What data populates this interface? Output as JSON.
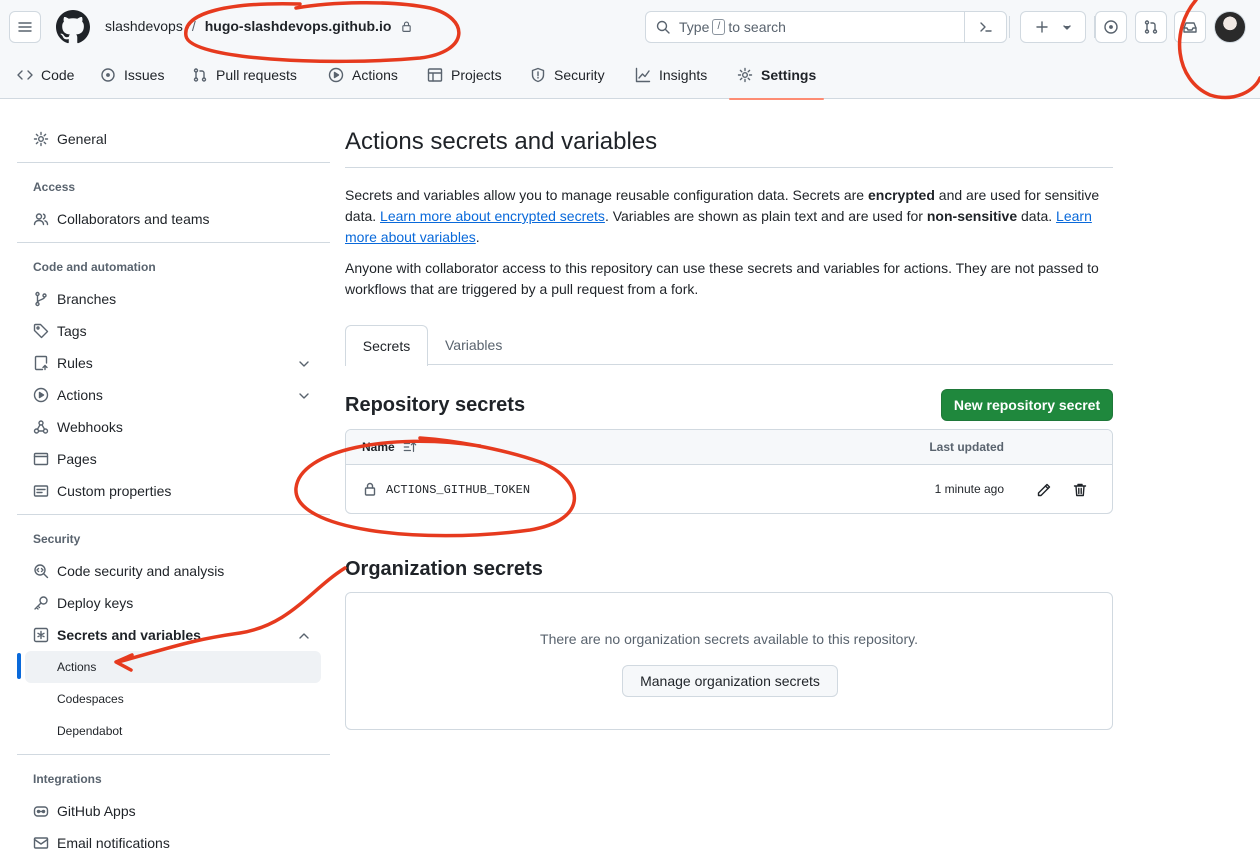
{
  "header": {
    "owner": "slashdevops",
    "separator": "/",
    "repo": "hugo-slashdevops.github.io",
    "search_type": "Type",
    "search_key": "/",
    "search_suffix": "to search"
  },
  "repo_nav": [
    {
      "label": "Code",
      "icon": "code-icon"
    },
    {
      "label": "Issues",
      "icon": "issue-opened-icon"
    },
    {
      "label": "Pull requests",
      "icon": "git-pull-request-icon"
    },
    {
      "label": "Actions",
      "icon": "play-icon"
    },
    {
      "label": "Projects",
      "icon": "table-icon"
    },
    {
      "label": "Security",
      "icon": "shield-icon"
    },
    {
      "label": "Insights",
      "icon": "graph-icon"
    },
    {
      "label": "Settings",
      "icon": "gear-icon",
      "active": true
    }
  ],
  "sidebar": {
    "general": "General",
    "access_heading": "Access",
    "collaborators": "Collaborators and teams",
    "code_heading": "Code and automation",
    "branches": "Branches",
    "tags": "Tags",
    "rules": "Rules",
    "actions": "Actions",
    "webhooks": "Webhooks",
    "pages": "Pages",
    "custom_properties": "Custom properties",
    "security_heading": "Security",
    "code_security": "Code security and analysis",
    "deploy_keys": "Deploy keys",
    "secrets_variables": "Secrets and variables",
    "sub_actions": "Actions",
    "sub_codespaces": "Codespaces",
    "sub_dependabot": "Dependabot",
    "integrations_heading": "Integrations",
    "github_apps": "GitHub Apps",
    "email_notifications": "Email notifications"
  },
  "main": {
    "title": "Actions secrets and variables",
    "p1_a": "Secrets and variables allow you to manage reusable configuration data. Secrets are ",
    "p1_b": "encrypted",
    "p1_c": " and are used for sensitive data. ",
    "p1_link1": "Learn more about encrypted secrets",
    "p1_d": ". Variables are shown as plain text and are used for ",
    "p1_e": "non-sensitive",
    "p1_f": " data. ",
    "p1_link2": "Learn more about variables",
    "p1_g": ".",
    "p2": "Anyone with collaborator access to this repository can use these secrets and variables for actions. They are not passed to workflows that are triggered by a pull request from a fork.",
    "tab_secrets": "Secrets",
    "tab_variables": "Variables",
    "repo_secrets_heading": "Repository secrets",
    "new_secret_button": "New repository secret",
    "col_name": "Name",
    "col_updated": "Last updated",
    "secrets": [
      {
        "name": "ACTIONS_GITHUB_TOKEN",
        "updated": "1 minute ago"
      }
    ],
    "org_secrets_heading": "Organization secrets",
    "org_empty": "There are no organization secrets available to this repository.",
    "manage_org_button": "Manage organization secrets"
  },
  "colors": {
    "accent": "#0969da",
    "primary_button": "#1f883d",
    "active_tab_underline": "#fd8c73",
    "annotation": "#e63a1e"
  }
}
